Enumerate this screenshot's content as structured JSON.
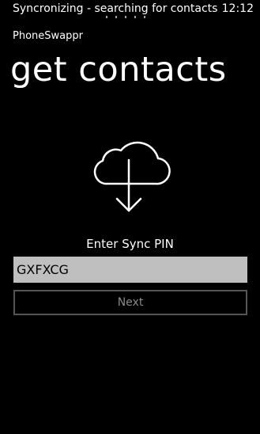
{
  "status_bar": {
    "text": "Syncronizing - searching for contacts",
    "time": "12:12"
  },
  "app": {
    "name": "PhoneSwappr",
    "page_title": "get contacts"
  },
  "icons": {
    "main": "cloud-download-icon"
  },
  "form": {
    "pin_label": "Enter Sync PIN",
    "pin_value": "GXFXCG",
    "next_label": "Next",
    "next_enabled": false
  },
  "colors": {
    "background": "#000000",
    "foreground": "#ffffff",
    "input_background": "#bfbfbf",
    "disabled_border": "#555555",
    "disabled_text": "#8a8a8a"
  }
}
